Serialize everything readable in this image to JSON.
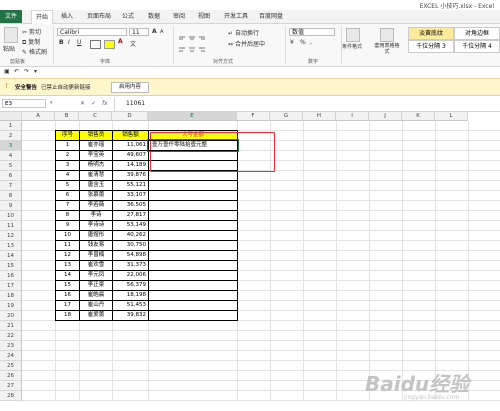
{
  "window": {
    "title": "EXCEL 小技巧.xlsx - Excel"
  },
  "tabs": [
    {
      "label": "文件"
    },
    {
      "label": "开始"
    },
    {
      "label": "插入"
    },
    {
      "label": "页面布局"
    },
    {
      "label": "公式"
    },
    {
      "label": "数据"
    },
    {
      "label": "审阅"
    },
    {
      "label": "视图"
    },
    {
      "label": "开发工具"
    },
    {
      "label": "百度网盘"
    }
  ],
  "ribbon": {
    "clipboard": {
      "paste": "粘贴",
      "cut": "剪切",
      "copy": "复制",
      "format_painter": "格式刷",
      "group": "剪贴板"
    },
    "font": {
      "name": "Calibri",
      "size": "11",
      "bold": "B",
      "italic": "I",
      "underline": "U",
      "grow": "A",
      "shrink": "A",
      "color_a": "A",
      "wen": "文",
      "group": "字体"
    },
    "alignment": {
      "wrap": "自动换行",
      "merge": "合并后居中",
      "group": "对齐方式"
    },
    "number": {
      "format": "数值",
      "percent": "%",
      "comma": ",",
      "group": "数字"
    },
    "styles": {
      "conditional": "条件格式",
      "table_format": "套用表格格式",
      "style1": "淡黄底纹",
      "style2": "对角边框",
      "style3": "千位分隔 3",
      "style4": "千位分隔 4"
    }
  },
  "security_bar": {
    "title": "安全警告",
    "message": "已禁止自动更新链接",
    "button": "启用内容"
  },
  "formula_bar": {
    "name_box": "E3",
    "cancel": "✕",
    "enter": "✓",
    "fx": "fx",
    "content": "11061"
  },
  "columns": [
    "A",
    "B",
    "C",
    "D",
    "E",
    "F",
    "G",
    "H",
    "I",
    "J",
    "K",
    "L"
  ],
  "rows": [
    "1",
    "2",
    "3",
    "4",
    "5",
    "6",
    "7",
    "8",
    "9",
    "10",
    "11",
    "12",
    "13",
    "14",
    "15",
    "16",
    "17",
    "18",
    "19",
    "20",
    "21",
    "22",
    "23",
    "24",
    "25",
    "26",
    "27",
    "28"
  ],
  "table": {
    "headers": [
      "序号",
      "销售员",
      "销售额",
      "大写金额"
    ],
    "rows": [
      {
        "no": "1",
        "name": "崔亦瑶",
        "amount": "11,061",
        "upper": "壹万壹仟零陆拾壹元整"
      },
      {
        "no": "2",
        "name": "李宝英",
        "amount": "49,607",
        "upper": ""
      },
      {
        "no": "3",
        "name": "杨明杰",
        "amount": "14,189",
        "upper": ""
      },
      {
        "no": "4",
        "name": "崔清慧",
        "amount": "39,876",
        "upper": ""
      },
      {
        "no": "5",
        "name": "唐含玉",
        "amount": "55,121",
        "upper": ""
      },
      {
        "no": "6",
        "name": "张慕蕾",
        "amount": "33,107",
        "upper": ""
      },
      {
        "no": "7",
        "name": "李若薇",
        "amount": "36,505",
        "upper": ""
      },
      {
        "no": "8",
        "name": "李诗",
        "amount": "27,817",
        "upper": ""
      },
      {
        "no": "9",
        "name": "李诗诗",
        "amount": "53,149",
        "upper": ""
      },
      {
        "no": "10",
        "name": "唐煜彤",
        "amount": "40,262",
        "upper": ""
      },
      {
        "no": "11",
        "name": "钱友易",
        "amount": "30,750",
        "upper": ""
      },
      {
        "no": "12",
        "name": "李曾楠",
        "amount": "54,898",
        "upper": ""
      },
      {
        "no": "13",
        "name": "崔欢雪",
        "amount": "31,373",
        "upper": ""
      },
      {
        "no": "14",
        "name": "李元凤",
        "amount": "22,006",
        "upper": ""
      },
      {
        "no": "15",
        "name": "李正豪",
        "amount": "56,379",
        "upper": ""
      },
      {
        "no": "16",
        "name": "崔皓晨",
        "amount": "18,198",
        "upper": ""
      },
      {
        "no": "17",
        "name": "崔山丹",
        "amount": "51,453",
        "upper": ""
      },
      {
        "no": "18",
        "name": "崔爱蕾",
        "amount": "39,832",
        "upper": ""
      }
    ]
  },
  "watermark": {
    "text": "Baidu经验",
    "sub": "jingyan.baidu.com"
  },
  "colors": {
    "header_fill": "#ffff00",
    "highlight_box": "#e0312c",
    "excel_green": "#217346"
  }
}
